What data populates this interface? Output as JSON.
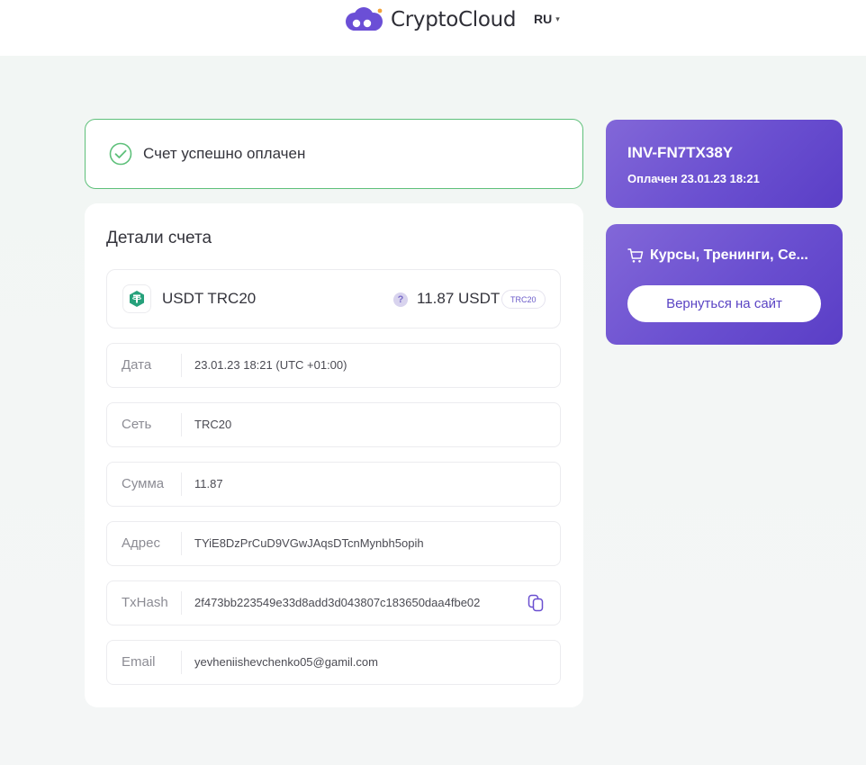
{
  "header": {
    "brand": "CryptoCloud",
    "language": "RU",
    "logo_icon": "cloud-logo-icon",
    "language_icon": "chevron-down-icon"
  },
  "status": {
    "message": "Счет успешно оплачен",
    "icon": "check-circle-icon",
    "color": "#5ec07a"
  },
  "details": {
    "title": "Детали счета",
    "coin": {
      "name": "USDT TRC20",
      "amount": "11.87 USDT",
      "network_badge": "TRC20",
      "help_glyph": "?",
      "icon": "tether-icon",
      "icon_color": "#26a17b"
    },
    "fields": [
      {
        "label": "Дата",
        "value": "23.01.23 18:21 (UTC +01:00)"
      },
      {
        "label": "Сеть",
        "value": "TRC20"
      },
      {
        "label": "Сумма",
        "value": "11.87"
      },
      {
        "label": "Адрес",
        "value": "TYiE8DzPrCuD9VGwJAqsDTcnMynbh5opih"
      },
      {
        "label": "TxHash",
        "value": "2f473bb223549e33d8add3d043807c183650daa4fbe02"
      },
      {
        "label": "Email",
        "value": "yevheniishevchenko05@gamil.com"
      }
    ],
    "copy_icon": "copy-icon"
  },
  "invoice": {
    "id": "INV-FN7TX38Y",
    "paid": "Оплачен 23.01.23 18:21"
  },
  "product": {
    "name": "Курсы, Тренинги, Се...",
    "icon": "cart-icon",
    "return_label": "Вернуться на сайт"
  },
  "colors": {
    "accent": "#6a4fd0",
    "success": "#5ec07a",
    "background": "#f3f6f5"
  }
}
